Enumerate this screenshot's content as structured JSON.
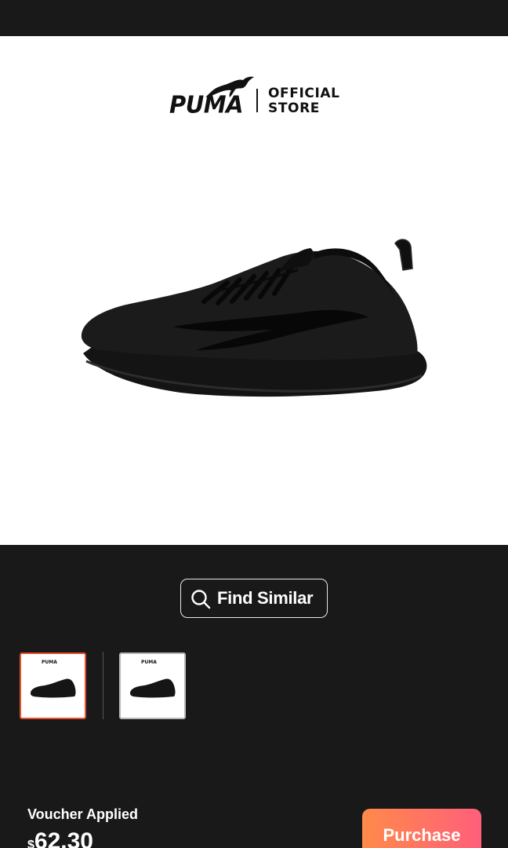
{
  "brand": {
    "wordmark": "PUMA",
    "store_line1": "OFFICIAL",
    "store_line2": "STORE"
  },
  "product_image": {
    "description_icon": "shoe-image"
  },
  "actions": {
    "find_similar_label": "Find Similar",
    "find_similar_icon": "search-icon"
  },
  "thumbnails": {
    "count": 2,
    "selected_index": 0,
    "mini_logo": "PUMA"
  },
  "footer": {
    "voucher_label": "Voucher Applied",
    "currency": "$",
    "price": "62.30",
    "purchase_label": "Purchase"
  },
  "colors": {
    "background": "#1a191a",
    "selected_border": "#e8502c",
    "purchase_gradient_start": "#ff8a4a",
    "purchase_gradient_end": "#ff5f7a"
  }
}
